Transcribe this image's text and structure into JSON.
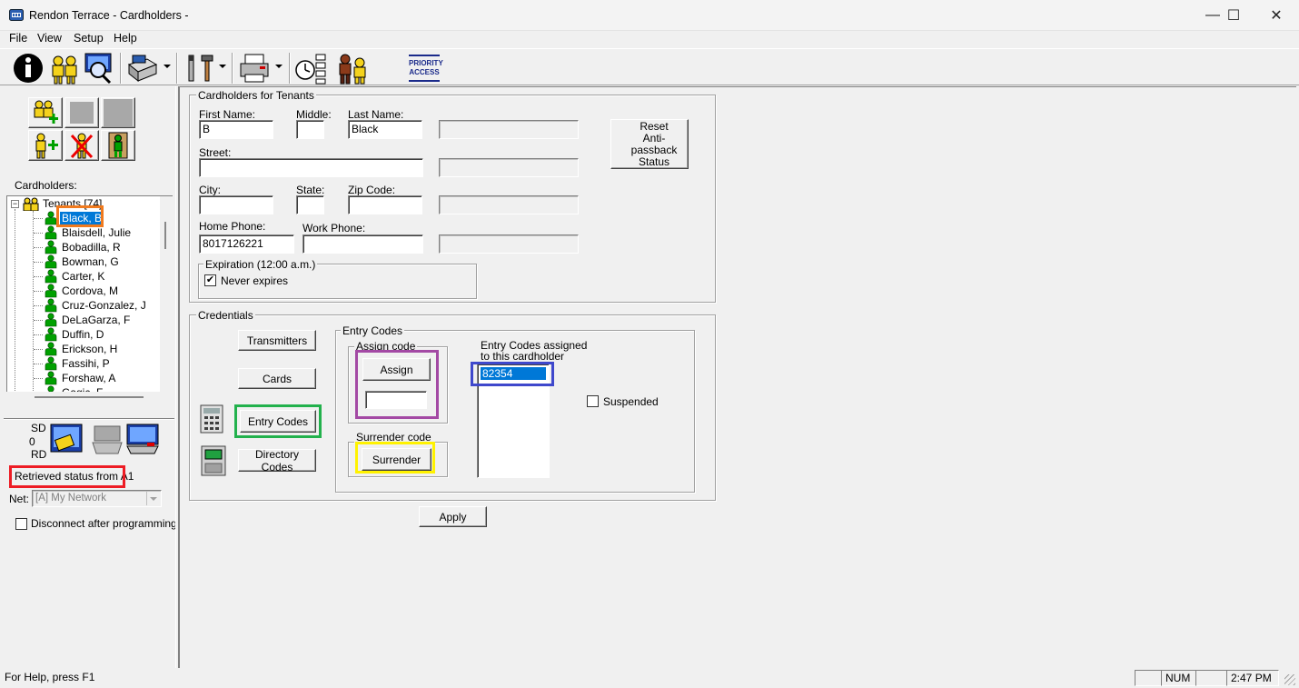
{
  "window": {
    "title": "Rendon Terrace - Cardholders -",
    "controls": {
      "minimize": "—",
      "maximize": "☐",
      "close": "✕"
    }
  },
  "menu": [
    "File",
    "View",
    "Setup",
    "Help"
  ],
  "toolbar": {
    "priority_access_line1": "PRIORITY",
    "priority_access_line2": "ACCESS"
  },
  "left": {
    "cardholders_label": "Cardholders:",
    "tree_root": "Tenants [74]",
    "tree_items": [
      "Black, B",
      "Blaisdell, Julie",
      "Bobadilla, R",
      "Bowman, G",
      "Carter, K",
      "Cordova, M",
      "Cruz-Gonzalez, J",
      "DeLaGarza, F",
      "Duffin, D",
      "Erickson, H",
      "Fassihi, P",
      "Forshaw, A",
      "Gagic, F"
    ],
    "selected_item": "Black, B",
    "sd_label": "SD",
    "sd_count": "0",
    "rd_label": "RD",
    "status_text": "Retrieved status from A1",
    "net_label": "Net:",
    "net_value": "[A] My Network",
    "disconnect_label": "Disconnect after programming",
    "disconnect_checked": false
  },
  "cardholder_form": {
    "group_title": "Cardholders for Tenants",
    "first_name_label": "First Name:",
    "first_name": "B",
    "middle_label": "Middle:",
    "middle": "",
    "last_name_label": "Last Name:",
    "last_name": "Black",
    "street_label": "Street:",
    "street": "",
    "city_label": "City:",
    "city": "",
    "state_label": "State:",
    "state": "",
    "zip_label": "Zip Code:",
    "zip": "",
    "home_phone_label": "Home Phone:",
    "home_phone": "8017126221",
    "work_phone_label": "Work Phone:",
    "work_phone": "",
    "expiration_title": "Expiration (12:00 a.m.)",
    "never_expires_label": "Never expires",
    "never_expires_checked": true,
    "reset_button_line1": "Reset",
    "reset_button_line2": "Anti-passback",
    "reset_button_line3": "Status"
  },
  "credentials": {
    "group_title": "Credentials",
    "transmitters_label": "Transmitters",
    "cards_label": "Cards",
    "entry_codes_label": "Entry Codes",
    "directory_codes_label": "Directory Codes",
    "entry_codes_group_title": "Entry Codes",
    "assign_code_title": "Assign code",
    "assign_button": "Assign",
    "assign_input": "",
    "surrender_code_title": "Surrender code",
    "surrender_button": "Surrender",
    "assigned_label_line1": "Entry Codes assigned",
    "assigned_label_line2": "to this cardholder",
    "assigned_codes": [
      "82354"
    ],
    "suspended_label": "Suspended",
    "suspended_checked": false
  },
  "apply_button": "Apply",
  "status_bar": {
    "help_text": "For Help, press F1",
    "num": "NUM",
    "time": "2:47 PM"
  },
  "colors": {
    "highlight_orange": "#f07a1e",
    "highlight_green": "#22b14c",
    "highlight_purple": "#a349a4",
    "highlight_yellow": "#fff200",
    "highlight_blue": "#3f48cc",
    "highlight_red": "#ed1c24",
    "selection": "#0078d7",
    "person_green": "#00a000"
  }
}
